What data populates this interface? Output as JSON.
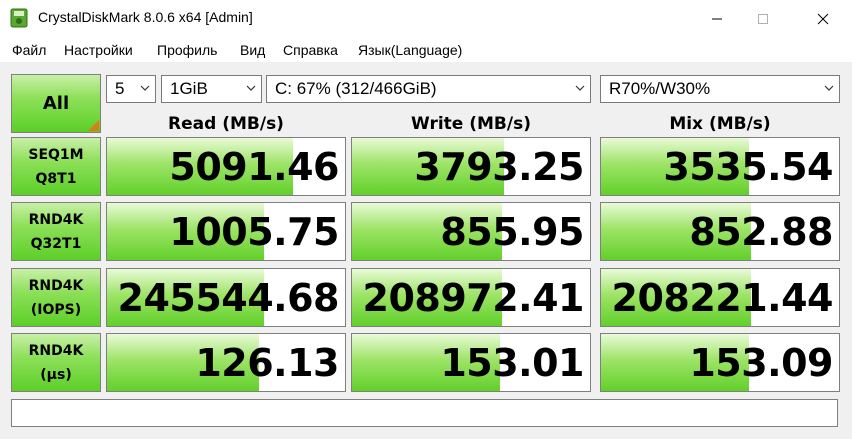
{
  "window": {
    "title": "CrystalDiskMark 8.0.6 x64 [Admin]"
  },
  "menu": {
    "items": [
      "Файл",
      "Настройки",
      "Профиль",
      "Вид",
      "Справка",
      "Язык(Language)"
    ]
  },
  "controls": {
    "all_label": "All",
    "count": "5",
    "size": "1GiB",
    "drive": "C: 67% (312/466GiB)",
    "mix_ratio": "R70%/W30%"
  },
  "headers": {
    "read": "Read (MB/s)",
    "write": "Write (MB/s)",
    "mix": "Mix (MB/s)"
  },
  "rows": [
    {
      "line1": "SEQ1M",
      "line2": "Q8T1",
      "read": "5091.46",
      "write": "3793.25",
      "mix": "3535.54",
      "read_level": 0.78,
      "write_level": 0.64,
      "mix_level": 0.62
    },
    {
      "line1": "RND4K",
      "line2": "Q32T1",
      "read": "1005.75",
      "write": "855.95",
      "mix": "852.88",
      "read_level": 0.66,
      "write_level": 0.63,
      "mix_level": 0.63
    },
    {
      "line1": "RND4K",
      "line2": "(IOPS)",
      "read": "245544.68",
      "write": "208972.41",
      "mix": "208221.44",
      "read_level": 0.66,
      "write_level": 0.63,
      "mix_level": 0.63
    },
    {
      "line1": "RND4K",
      "line2": "(µs)",
      "read": "126.13",
      "write": "153.01",
      "mix": "153.09",
      "read_level": 0.64,
      "write_level": 0.62,
      "mix_level": 0.62
    }
  ],
  "comment": "",
  "colors": {
    "accent_green": "#5ccf28",
    "corner_orange": "#e07a18"
  }
}
